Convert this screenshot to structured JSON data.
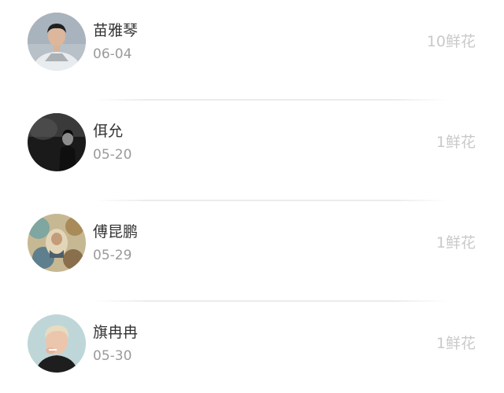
{
  "list": {
    "items": [
      {
        "name": "苗雅琴",
        "date": "06-04",
        "flowers": "10鲜花",
        "avatar": "person-photo"
      },
      {
        "name": "佴允",
        "date": "05-20",
        "flowers": "1鲜花",
        "avatar": "person-photo"
      },
      {
        "name": "傅昆鹏",
        "date": "05-29",
        "flowers": "1鲜花",
        "avatar": "artwork-photo"
      },
      {
        "name": "旗冉冉",
        "date": "05-30",
        "flowers": "1鲜花",
        "avatar": "person-photo"
      }
    ]
  },
  "colors": {
    "name_text": "#333333",
    "date_text": "#9a9a9a",
    "flowers_text": "#c9c9c9",
    "divider": "#ececec",
    "background": "#ffffff"
  }
}
